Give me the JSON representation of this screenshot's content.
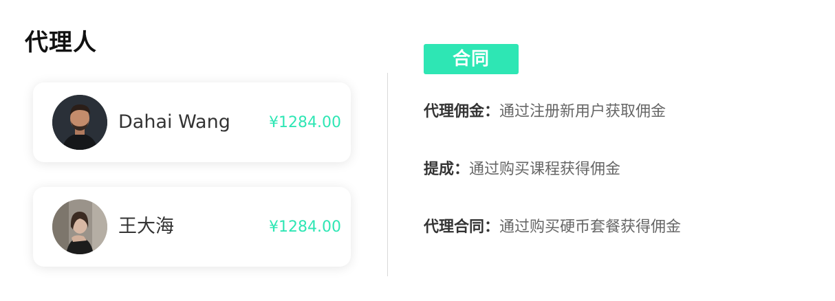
{
  "page": {
    "title": "代理人"
  },
  "agents": [
    {
      "name": "Dahai Wang",
      "amount": "¥1284.00",
      "avatar": "avatar-man"
    },
    {
      "name": "王大海",
      "amount": "¥1284.00",
      "avatar": "avatar-woman"
    }
  ],
  "contract": {
    "tag_label": "合同",
    "rules": [
      {
        "label": "代理佣金：",
        "desc": "通过注册新用户获取佣金"
      },
      {
        "label": "提成：",
        "desc": "通过购买课程获得佣金"
      },
      {
        "label": "代理合同：",
        "desc": "通过购买硬币套餐获得佣金"
      }
    ]
  },
  "colors": {
    "accent": "#2ee6b4",
    "title": "#111111",
    "text": "#333333",
    "muted": "#666666"
  }
}
